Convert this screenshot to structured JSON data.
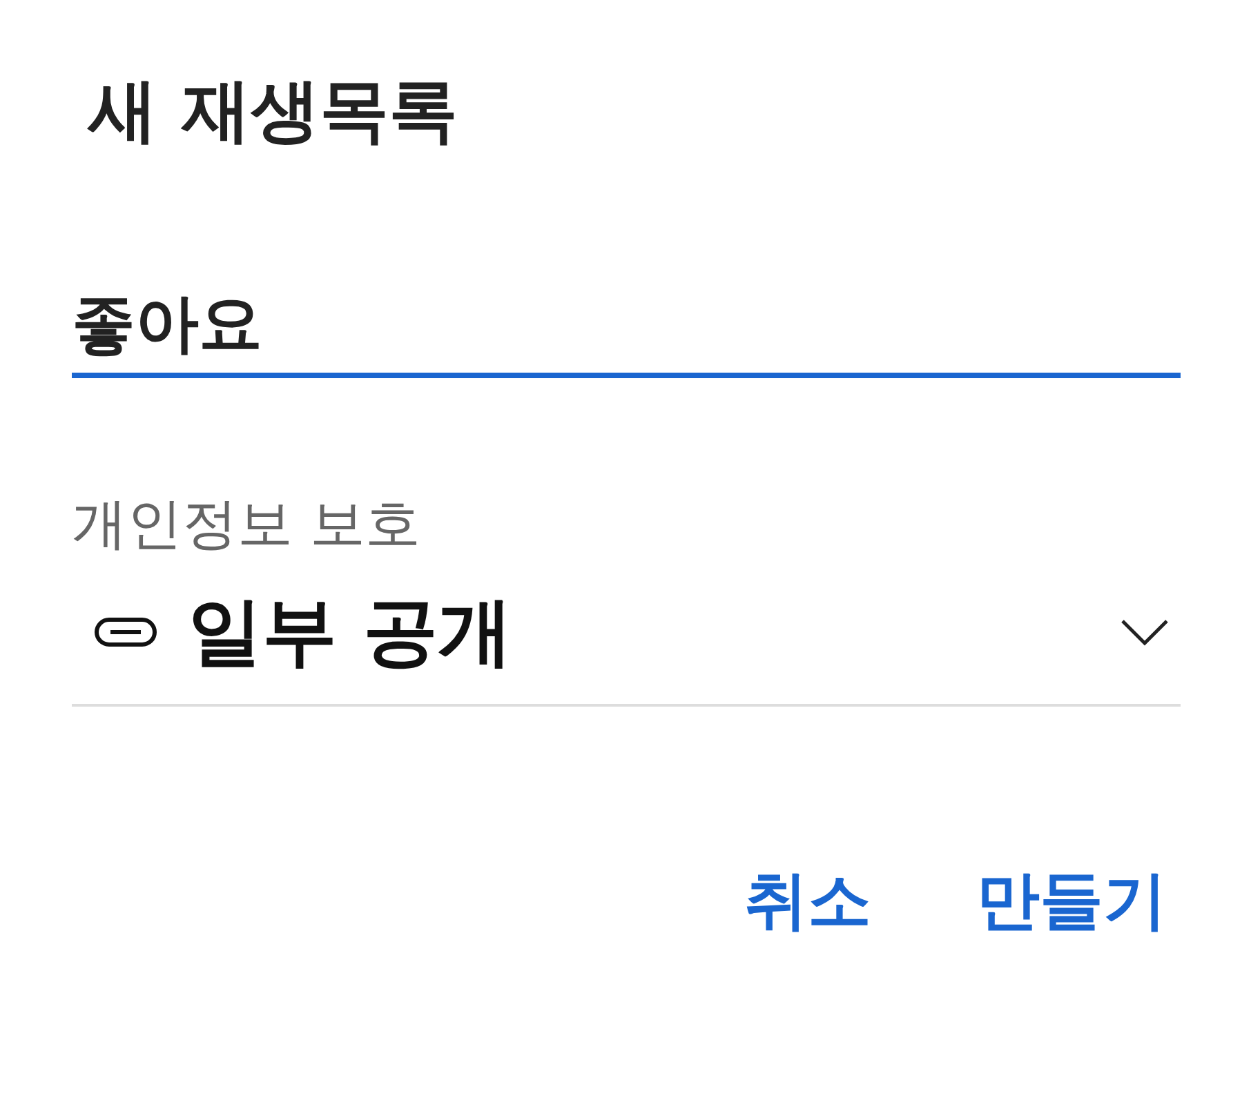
{
  "title": "새 재생목록",
  "name_field": {
    "value": "좋아요",
    "focused": true
  },
  "privacy": {
    "label": "개인정보 보호",
    "value": "일부 공개"
  },
  "buttons": [
    {
      "label": "취소"
    },
    {
      "label": "만들기"
    }
  ]
}
